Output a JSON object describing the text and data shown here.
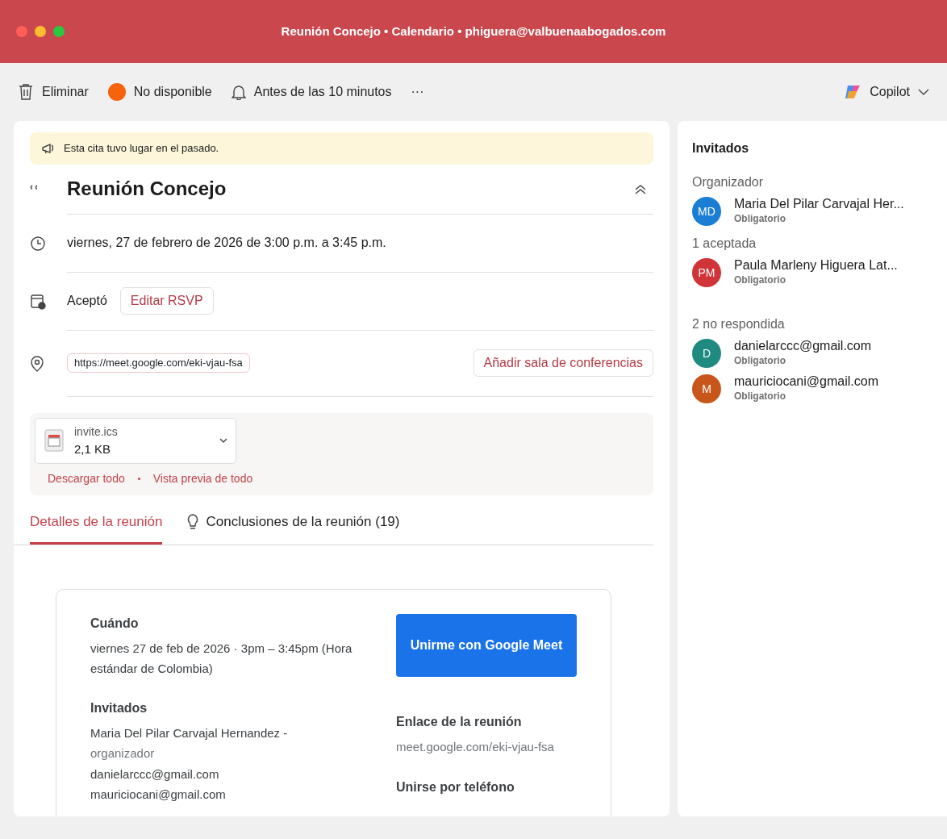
{
  "window": {
    "title": "Reunión Concejo • Calendario • phiguera@valbuenaabogados.com"
  },
  "toolbar": {
    "items": [
      {
        "kind": "delete",
        "label": "Eliminar"
      },
      {
        "kind": "status",
        "label": "No disponible",
        "color": "#f7630c"
      },
      {
        "kind": "reminder",
        "label": "Antes de las 10 minutos"
      },
      {
        "kind": "more",
        "label": "···"
      }
    ],
    "copilot": {
      "label": "Copilot"
    }
  },
  "event": {
    "notice": "Esta cita tuvo lugar en el pasado.",
    "title": "Reunión Concejo",
    "time": "viernes, 27 de febrero de 2026 de 3:00 p.m. a 3:45 p.m.",
    "response": "Aceptó",
    "edit_rsvp": "Editar RSVP",
    "location": "https://meet.google.com/eki-vjau-fsa",
    "add_room": "Añadir sala de conferencias",
    "attachment": {
      "name": "invite.ics",
      "size": "2,1 KB"
    },
    "attachment_actions": [
      "Descargar todo",
      "Vista previa de todo"
    ]
  },
  "tabs": [
    {
      "label": "Detalles de la reunión",
      "selected": true,
      "kind": "plain"
    },
    {
      "label": "Conclusiones de la reunión (19)",
      "selected": false,
      "kind": "bulb"
    }
  ],
  "details": {
    "when_heading": "Cuándo",
    "when": "viernes 27 de feb de 2026 · 3pm – 3:45pm (Hora estándar de Colombia)",
    "guests_heading": "Invitados",
    "guests": [
      {
        "text": "Maria Del Pilar Carvajal Hernandez -",
        "role": "organizador"
      },
      {
        "text": "danielarccc@gmail.com"
      },
      {
        "text": "mauriciocani@gmail.com"
      }
    ],
    "join_button": "Unirme con Google Meet",
    "link_heading": "Enlace de la reunión",
    "link": "meet.google.com/eki-vjau-fsa",
    "phone_heading": "Unirse por teléfono"
  },
  "attendees": {
    "title": "Invitados",
    "groups": [
      {
        "label": "Organizador",
        "people": [
          {
            "initials": "MD",
            "name": "Maria Del Pilar Carvajal Her...",
            "role": "Obligatorio",
            "color": "#1a7fd4"
          }
        ]
      },
      {
        "label": "1 aceptada",
        "people": [
          {
            "initials": "PM",
            "name": "Paula Marleny  Higuera Lat...",
            "role": "Obligatorio",
            "color": "#d13438"
          }
        ]
      },
      {
        "label": "2 no respondida",
        "people": [
          {
            "initials": "D",
            "name": "danielarccc@gmail.com",
            "role": "Obligatorio",
            "color": "#1f8a80"
          },
          {
            "initials": "M",
            "name": "mauriciocani@gmail.com",
            "role": "Obligatorio",
            "color": "#c8561a"
          }
        ]
      }
    ]
  }
}
